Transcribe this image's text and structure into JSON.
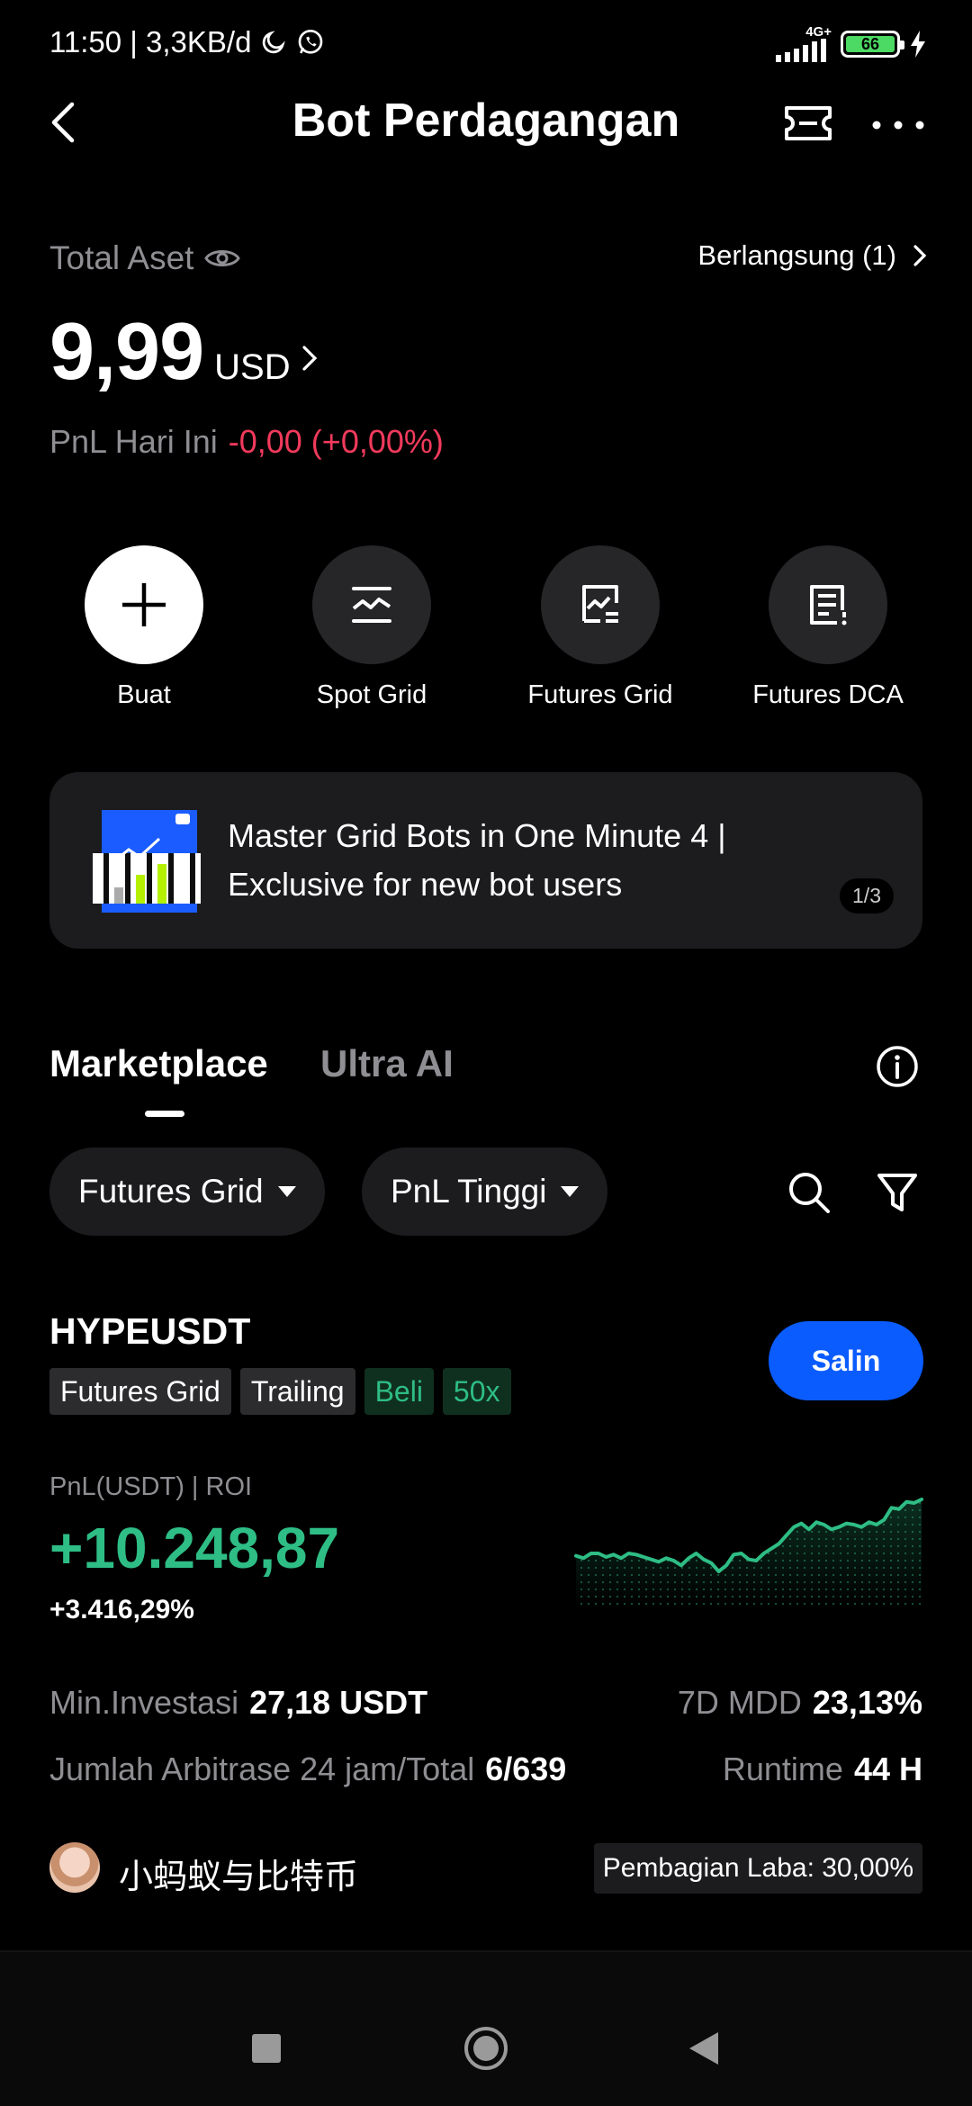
{
  "status_bar": {
    "time_speed": "11:50 | 3,3KB/d",
    "network": "4G+",
    "battery": "66"
  },
  "header": {
    "title": "Bot Perdagangan"
  },
  "assets": {
    "label": "Total Aset",
    "running": "Berlangsung (1)",
    "amount": "9,99",
    "unit": "USD",
    "pnl_label": "PnL Hari Ini",
    "pnl_value": "-0,00 (+0,00%)"
  },
  "shortcuts": [
    {
      "label": "Buat",
      "icon": "plus-icon"
    },
    {
      "label": "Spot Grid",
      "icon": "spot-grid-icon"
    },
    {
      "label": "Futures Grid",
      "icon": "futures-grid-icon"
    },
    {
      "label": "Futures DCA",
      "icon": "futures-dca-icon"
    }
  ],
  "banner": {
    "text": "Master Grid Bots in One Minute 4 | Exclusive for new bot users",
    "pager": "1/3"
  },
  "tabs": {
    "marketplace": "Marketplace",
    "ultra_ai": "Ultra AI",
    "active": "Marketplace"
  },
  "filters": {
    "type": "Futures Grid",
    "sort": "PnL Tinggi"
  },
  "bot": {
    "pair": "HYPEUSDT",
    "tags": [
      "Futures Grid",
      "Trailing",
      "Beli",
      "50x"
    ],
    "copy_label": "Salin",
    "pnl_label": "PnL(USDT) | ROI",
    "pnl_value": "+10.248,87",
    "roi_value": "+3.416,29%",
    "sparkline": [
      48,
      46,
      50,
      50,
      47,
      49,
      46,
      50,
      49,
      47,
      45,
      43,
      46,
      44,
      40,
      46,
      50,
      45,
      42,
      35,
      40,
      49,
      50,
      45,
      44,
      50,
      54,
      58,
      65,
      72,
      75,
      70,
      76,
      74,
      70,
      72,
      75,
      74,
      72,
      76,
      74,
      78,
      88,
      87,
      93,
      92,
      95
    ],
    "sparkline_color": "#2ebd85",
    "stats": {
      "min_invest_label": "Min.Investasi",
      "min_invest_value": "27,18 USDT",
      "mdd_label": "7D MDD",
      "mdd_value": "23,13%",
      "arb_label": "Jumlah Arbitrase 24 jam/Total",
      "arb_value": "6/639",
      "runtime_label": "Runtime",
      "runtime_value": "44 H"
    },
    "owner": "小蚂蚁与比特币",
    "profit_share": "Pembagian Laba: 30,00%"
  },
  "colors": {
    "accent": "#0a5cff",
    "positive": "#2ebd85",
    "negative": "#f23a5c",
    "background": "#000000"
  }
}
